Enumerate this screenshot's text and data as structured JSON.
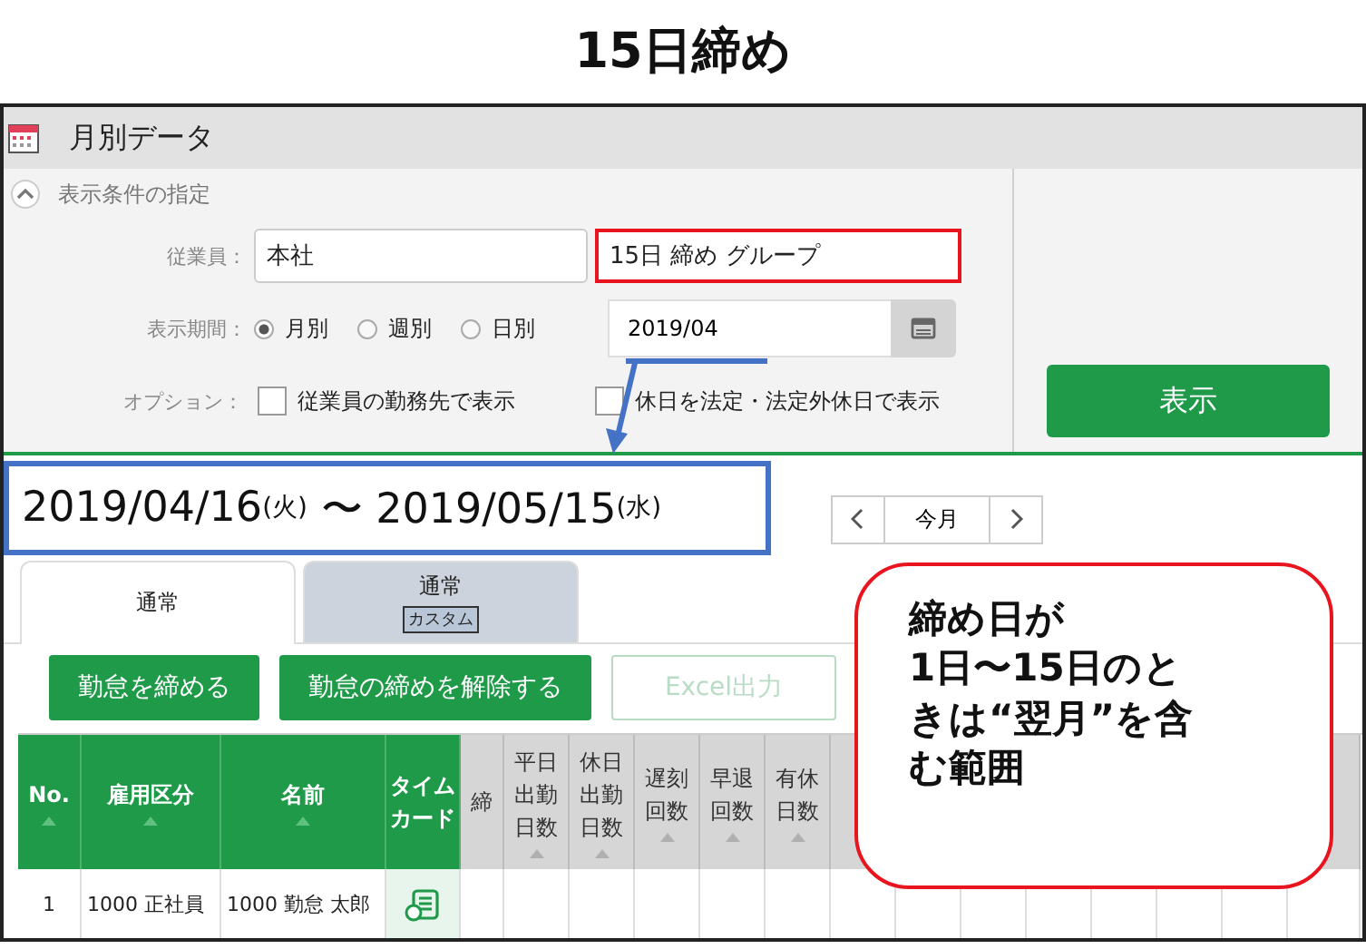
{
  "page_title": "15日締め",
  "window": {
    "title": "月別データ"
  },
  "conditions": {
    "section_title": "表示条件の指定",
    "expanded": true,
    "employee": {
      "label": "従業員：",
      "fields": [
        {
          "value": "本社",
          "highlighted": false
        },
        {
          "value": "15日 締め グループ",
          "highlighted": true
        }
      ]
    },
    "period": {
      "label": "表示期間：",
      "options": [
        {
          "label": "月別",
          "selected": true
        },
        {
          "label": "週別",
          "selected": false
        },
        {
          "label": "日別",
          "selected": false
        }
      ],
      "date": "2019/04"
    },
    "options": {
      "label": "オプション：",
      "items": [
        {
          "label": "従業員の勤務先で表示",
          "checked": false
        },
        {
          "label": "休日を法定・法定外休日で表示",
          "checked": false
        }
      ]
    },
    "show_button": "表示"
  },
  "range": {
    "start": "2019/04/16",
    "start_day": "(火)",
    "separator": "〜",
    "end": "2019/05/15",
    "end_day": "(水)"
  },
  "nav": {
    "today": "今月"
  },
  "tabs": [
    {
      "label": "通常",
      "selected": true
    },
    {
      "label": "通常",
      "badge": "カスタム",
      "selected": false
    }
  ],
  "actions": [
    {
      "label": "勤怠を締める",
      "disabled": false
    },
    {
      "label": "勤怠の締めを解除する",
      "disabled": false
    },
    {
      "label": "Excel出力",
      "disabled": true
    }
  ],
  "table": {
    "columns": [
      {
        "label": "No.",
        "kind": "fixed",
        "sortable": true
      },
      {
        "label": "雇用区分",
        "kind": "fixed",
        "sortable": true
      },
      {
        "label": "名前",
        "kind": "fixed",
        "sortable": true
      },
      {
        "label": "タイムカード",
        "kind": "fixed",
        "sortable": false
      },
      {
        "label": "締",
        "kind": "data",
        "sortable": false
      },
      {
        "label": "平日出勤日数",
        "kind": "data",
        "sortable": true
      },
      {
        "label": "休日出勤日数",
        "kind": "data",
        "sortable": true
      },
      {
        "label": "遅刻回数",
        "kind": "data",
        "sortable": true
      },
      {
        "label": "早退回数",
        "kind": "data",
        "sortable": true
      },
      {
        "label": "有休日数",
        "kind": "data",
        "sortable": true
      }
    ],
    "rows": [
      {
        "cells": [
          "1",
          "1000 正社員",
          "1000 勤怠 太郎"
        ],
        "timecard": true
      }
    ]
  },
  "callout": {
    "lines": [
      "締め日が",
      "1日〜15日のと",
      "きは“翌月”を含",
      "む範囲"
    ]
  }
}
